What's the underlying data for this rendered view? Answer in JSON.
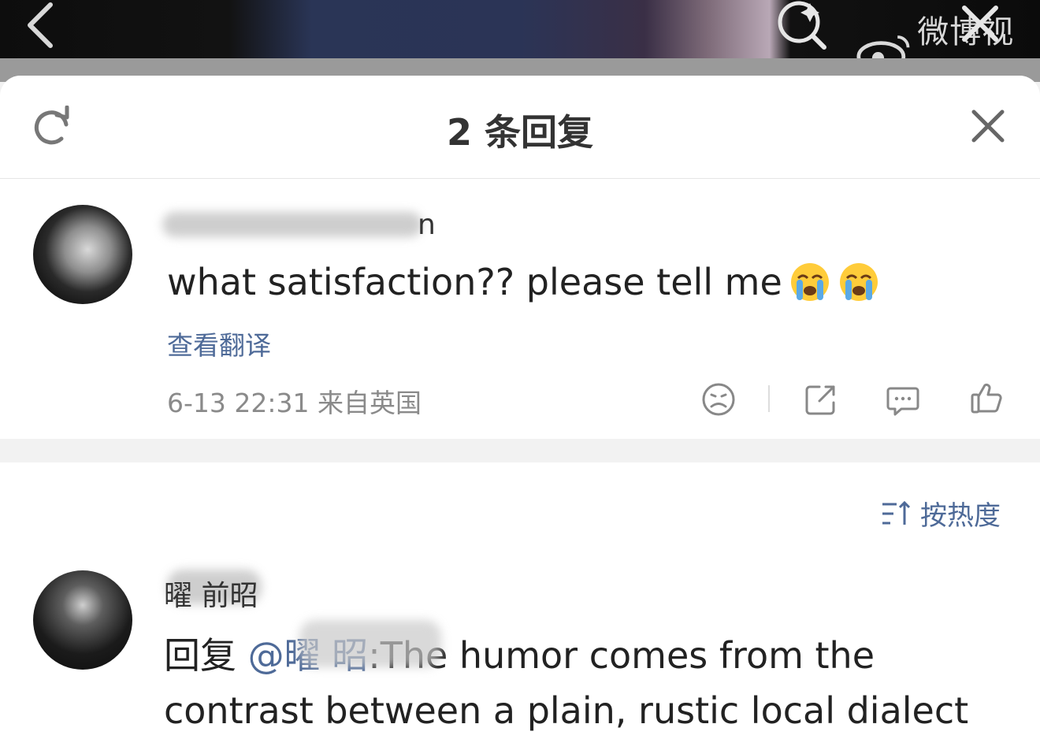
{
  "video_bar": {
    "brand_text": "微博视频"
  },
  "sheet": {
    "title": "2 条回复"
  },
  "root_comment": {
    "username_visible_fragment": "n",
    "text": "what satisfaction?? please tell me",
    "emoji_count": 2,
    "translate_label": "查看翻译",
    "meta": "6-13 22:31 来自英国"
  },
  "replies": {
    "sort_label": "按热度",
    "items": [
      {
        "username_visible_fragment": "曜 前昭",
        "reply_prefix": "回复",
        "mention": "@曜 昭",
        "text": ":The humor comes from the contrast between a plain, rustic local dialect"
      }
    ]
  },
  "icons": {
    "back": "chevron-left-icon",
    "search": "search-icon",
    "weibo": "weibo-logo-icon",
    "close": "close-icon",
    "refresh": "refresh-icon",
    "dislike": "frown-icon",
    "share": "share-icon",
    "comment": "comment-icon",
    "like": "thumbs-up-icon",
    "sort": "sort-icon"
  },
  "colors": {
    "link": "#4e6a98",
    "text": "#222222",
    "meta": "#8a8a8a"
  }
}
